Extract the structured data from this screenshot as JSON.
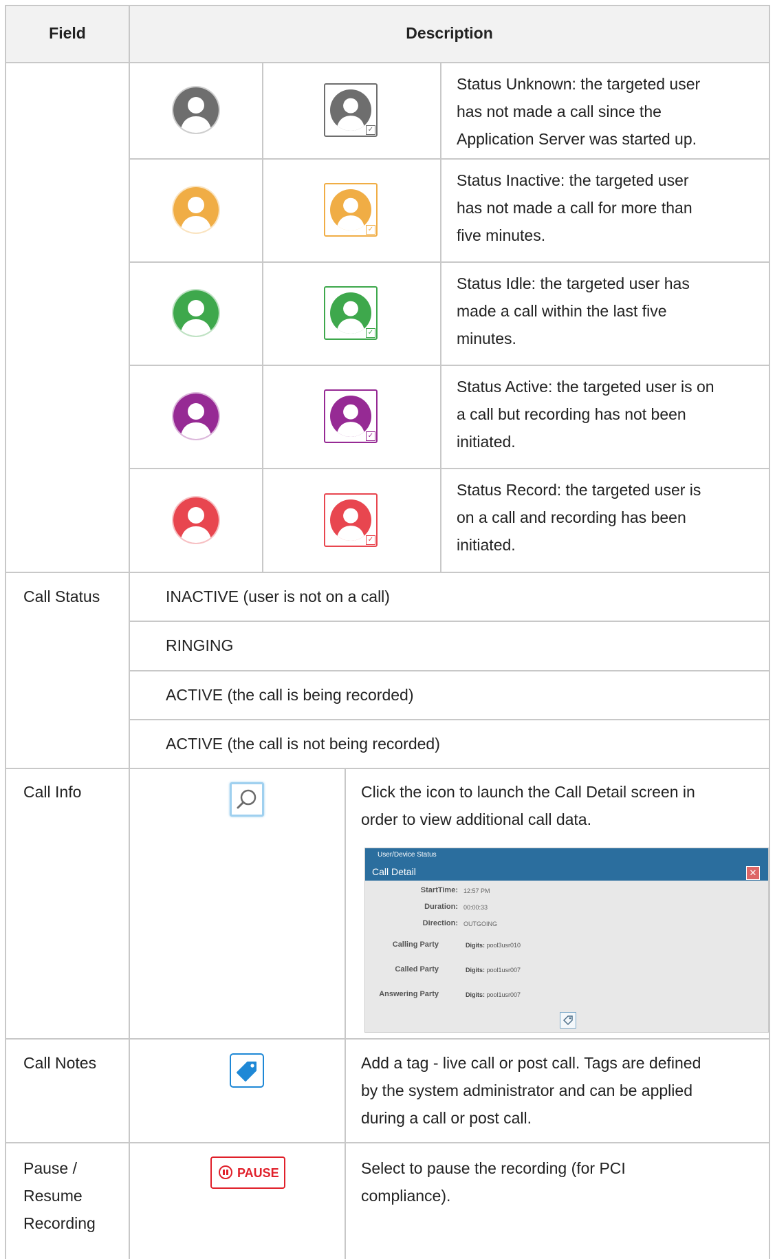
{
  "header": {
    "field": "Field",
    "description": "Description"
  },
  "status_rows": [
    {
      "color": "#6e6e6e",
      "name": "status-unknown",
      "text": [
        "Status Unknown: the targeted user",
        "has not made a call since the",
        "Application Server was started up."
      ]
    },
    {
      "color": "#f0ad45",
      "name": "status-inactive",
      "text": [
        "Status Inactive: the targeted user",
        "has not made a call for more than",
        "five minutes."
      ]
    },
    {
      "color": "#3ea84c",
      "name": "status-idle",
      "text": [
        "Status Idle: the targeted user has",
        "made a call within the last five",
        "minutes."
      ]
    },
    {
      "color": "#962a94",
      "name": "status-active",
      "text": [
        "Status Active: the targeted user is on",
        "a call but recording has not been",
        "initiated."
      ]
    },
    {
      "color": "#e8464f",
      "name": "status-record",
      "text": [
        "Status Record: the targeted user is",
        "on a call and recording has been",
        "initiated."
      ]
    }
  ],
  "call_status": {
    "field": "Call Status",
    "items": [
      "INACTIVE (user is not on a call)",
      "RINGING",
      "ACTIVE (the call is being recorded)",
      "ACTIVE (the call is not being recorded)"
    ]
  },
  "call_info": {
    "field": "Call Info",
    "icon": "search-icon",
    "text": [
      "Click the icon to launch the Call Detail screen in",
      "order to view additional call data."
    ],
    "screenshot": {
      "breadcrumb": "User/Device Status",
      "title": "Call Detail",
      "close": "✕",
      "start_label": "StartTime:",
      "start_value": "12:57 PM",
      "duration_label": "Duration:",
      "duration_value": "00:00:33",
      "direction_label": "Direction:",
      "direction_value": "OUTGOING",
      "digits_label": "Digits:",
      "parties": [
        {
          "label": "Calling Party",
          "digits": "pool3usr010"
        },
        {
          "label": "Called Party",
          "digits": "pool1usr007"
        },
        {
          "label": "Answering Party",
          "digits": "pool1usr007"
        }
      ]
    }
  },
  "call_notes": {
    "field": "Call Notes",
    "icon": "tag-icon",
    "text": [
      "Add a tag - live call or post call. Tags are defined",
      "by the system administrator and can be applied",
      "during a call or post call."
    ]
  },
  "pause": {
    "field": [
      "Pause /",
      "Resume",
      "Recording"
    ],
    "button_label": "PAUSE",
    "text": [
      "Select to pause the recording (for PCI",
      "compliance)."
    ]
  },
  "colors": {
    "border": "#c8c8c8",
    "header_bg": "#f2f2f2",
    "pause_red": "#e0202a",
    "tag_blue": "#1e88d6"
  }
}
